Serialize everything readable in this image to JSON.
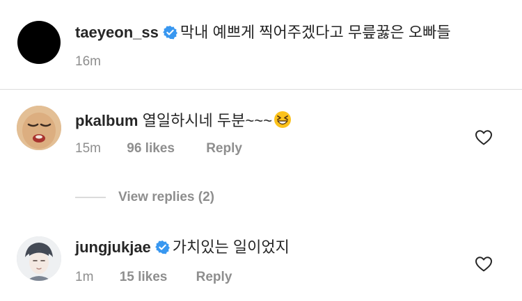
{
  "caption": {
    "username": "taeyeon_ss",
    "text": "막내 예쁘게 찍어주겠다고 무릎꿇은 오빠들",
    "time": "16m"
  },
  "comments": [
    {
      "username": "pkalbum",
      "text": "열일하시네 두분~~~",
      "emoji": "grinning-squinting-face-emoji",
      "time": "15m",
      "likes": "96 likes",
      "reply": "Reply",
      "view_replies": "View replies (2)"
    },
    {
      "username": "jungjukjae",
      "text": "가치있는 일이었지",
      "time": "1m",
      "likes": "15 likes",
      "reply": "Reply"
    }
  ],
  "colors": {
    "text": "#262626",
    "secondary": "#8e8e8e",
    "verified": "#3897f0",
    "divider": "#dbdbdb"
  }
}
